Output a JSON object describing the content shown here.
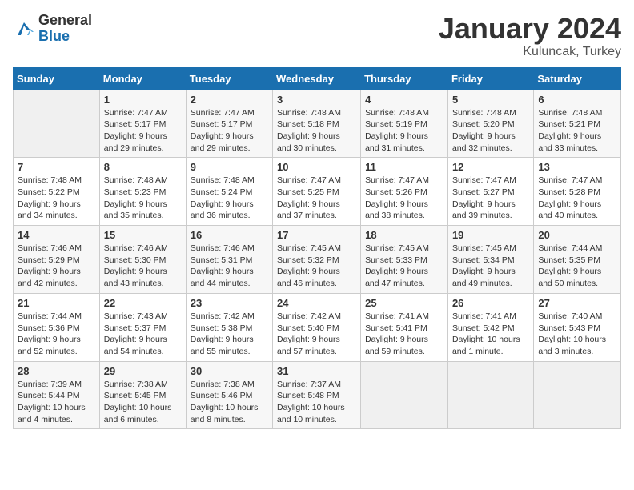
{
  "logo": {
    "general": "General",
    "blue": "Blue"
  },
  "title": "January 2024",
  "subtitle": "Kuluncak, Turkey",
  "days_header": [
    "Sunday",
    "Monday",
    "Tuesday",
    "Wednesday",
    "Thursday",
    "Friday",
    "Saturday"
  ],
  "weeks": [
    [
      {
        "num": "",
        "sunrise": "",
        "sunset": "",
        "daylight": "",
        "empty": true
      },
      {
        "num": "1",
        "sunrise": "Sunrise: 7:47 AM",
        "sunset": "Sunset: 5:17 PM",
        "daylight": "Daylight: 9 hours and 29 minutes."
      },
      {
        "num": "2",
        "sunrise": "Sunrise: 7:47 AM",
        "sunset": "Sunset: 5:17 PM",
        "daylight": "Daylight: 9 hours and 29 minutes."
      },
      {
        "num": "3",
        "sunrise": "Sunrise: 7:48 AM",
        "sunset": "Sunset: 5:18 PM",
        "daylight": "Daylight: 9 hours and 30 minutes."
      },
      {
        "num": "4",
        "sunrise": "Sunrise: 7:48 AM",
        "sunset": "Sunset: 5:19 PM",
        "daylight": "Daylight: 9 hours and 31 minutes."
      },
      {
        "num": "5",
        "sunrise": "Sunrise: 7:48 AM",
        "sunset": "Sunset: 5:20 PM",
        "daylight": "Daylight: 9 hours and 32 minutes."
      },
      {
        "num": "6",
        "sunrise": "Sunrise: 7:48 AM",
        "sunset": "Sunset: 5:21 PM",
        "daylight": "Daylight: 9 hours and 33 minutes."
      }
    ],
    [
      {
        "num": "7",
        "sunrise": "Sunrise: 7:48 AM",
        "sunset": "Sunset: 5:22 PM",
        "daylight": "Daylight: 9 hours and 34 minutes."
      },
      {
        "num": "8",
        "sunrise": "Sunrise: 7:48 AM",
        "sunset": "Sunset: 5:23 PM",
        "daylight": "Daylight: 9 hours and 35 minutes."
      },
      {
        "num": "9",
        "sunrise": "Sunrise: 7:48 AM",
        "sunset": "Sunset: 5:24 PM",
        "daylight": "Daylight: 9 hours and 36 minutes."
      },
      {
        "num": "10",
        "sunrise": "Sunrise: 7:47 AM",
        "sunset": "Sunset: 5:25 PM",
        "daylight": "Daylight: 9 hours and 37 minutes."
      },
      {
        "num": "11",
        "sunrise": "Sunrise: 7:47 AM",
        "sunset": "Sunset: 5:26 PM",
        "daylight": "Daylight: 9 hours and 38 minutes."
      },
      {
        "num": "12",
        "sunrise": "Sunrise: 7:47 AM",
        "sunset": "Sunset: 5:27 PM",
        "daylight": "Daylight: 9 hours and 39 minutes."
      },
      {
        "num": "13",
        "sunrise": "Sunrise: 7:47 AM",
        "sunset": "Sunset: 5:28 PM",
        "daylight": "Daylight: 9 hours and 40 minutes."
      }
    ],
    [
      {
        "num": "14",
        "sunrise": "Sunrise: 7:46 AM",
        "sunset": "Sunset: 5:29 PM",
        "daylight": "Daylight: 9 hours and 42 minutes."
      },
      {
        "num": "15",
        "sunrise": "Sunrise: 7:46 AM",
        "sunset": "Sunset: 5:30 PM",
        "daylight": "Daylight: 9 hours and 43 minutes."
      },
      {
        "num": "16",
        "sunrise": "Sunrise: 7:46 AM",
        "sunset": "Sunset: 5:31 PM",
        "daylight": "Daylight: 9 hours and 44 minutes."
      },
      {
        "num": "17",
        "sunrise": "Sunrise: 7:45 AM",
        "sunset": "Sunset: 5:32 PM",
        "daylight": "Daylight: 9 hours and 46 minutes."
      },
      {
        "num": "18",
        "sunrise": "Sunrise: 7:45 AM",
        "sunset": "Sunset: 5:33 PM",
        "daylight": "Daylight: 9 hours and 47 minutes."
      },
      {
        "num": "19",
        "sunrise": "Sunrise: 7:45 AM",
        "sunset": "Sunset: 5:34 PM",
        "daylight": "Daylight: 9 hours and 49 minutes."
      },
      {
        "num": "20",
        "sunrise": "Sunrise: 7:44 AM",
        "sunset": "Sunset: 5:35 PM",
        "daylight": "Daylight: 9 hours and 50 minutes."
      }
    ],
    [
      {
        "num": "21",
        "sunrise": "Sunrise: 7:44 AM",
        "sunset": "Sunset: 5:36 PM",
        "daylight": "Daylight: 9 hours and 52 minutes."
      },
      {
        "num": "22",
        "sunrise": "Sunrise: 7:43 AM",
        "sunset": "Sunset: 5:37 PM",
        "daylight": "Daylight: 9 hours and 54 minutes."
      },
      {
        "num": "23",
        "sunrise": "Sunrise: 7:42 AM",
        "sunset": "Sunset: 5:38 PM",
        "daylight": "Daylight: 9 hours and 55 minutes."
      },
      {
        "num": "24",
        "sunrise": "Sunrise: 7:42 AM",
        "sunset": "Sunset: 5:40 PM",
        "daylight": "Daylight: 9 hours and 57 minutes."
      },
      {
        "num": "25",
        "sunrise": "Sunrise: 7:41 AM",
        "sunset": "Sunset: 5:41 PM",
        "daylight": "Daylight: 9 hours and 59 minutes."
      },
      {
        "num": "26",
        "sunrise": "Sunrise: 7:41 AM",
        "sunset": "Sunset: 5:42 PM",
        "daylight": "Daylight: 10 hours and 1 minute."
      },
      {
        "num": "27",
        "sunrise": "Sunrise: 7:40 AM",
        "sunset": "Sunset: 5:43 PM",
        "daylight": "Daylight: 10 hours and 3 minutes."
      }
    ],
    [
      {
        "num": "28",
        "sunrise": "Sunrise: 7:39 AM",
        "sunset": "Sunset: 5:44 PM",
        "daylight": "Daylight: 10 hours and 4 minutes."
      },
      {
        "num": "29",
        "sunrise": "Sunrise: 7:38 AM",
        "sunset": "Sunset: 5:45 PM",
        "daylight": "Daylight: 10 hours and 6 minutes."
      },
      {
        "num": "30",
        "sunrise": "Sunrise: 7:38 AM",
        "sunset": "Sunset: 5:46 PM",
        "daylight": "Daylight: 10 hours and 8 minutes."
      },
      {
        "num": "31",
        "sunrise": "Sunrise: 7:37 AM",
        "sunset": "Sunset: 5:48 PM",
        "daylight": "Daylight: 10 hours and 10 minutes."
      },
      {
        "num": "",
        "sunrise": "",
        "sunset": "",
        "daylight": "",
        "empty": true
      },
      {
        "num": "",
        "sunrise": "",
        "sunset": "",
        "daylight": "",
        "empty": true
      },
      {
        "num": "",
        "sunrise": "",
        "sunset": "",
        "daylight": "",
        "empty": true
      }
    ]
  ]
}
